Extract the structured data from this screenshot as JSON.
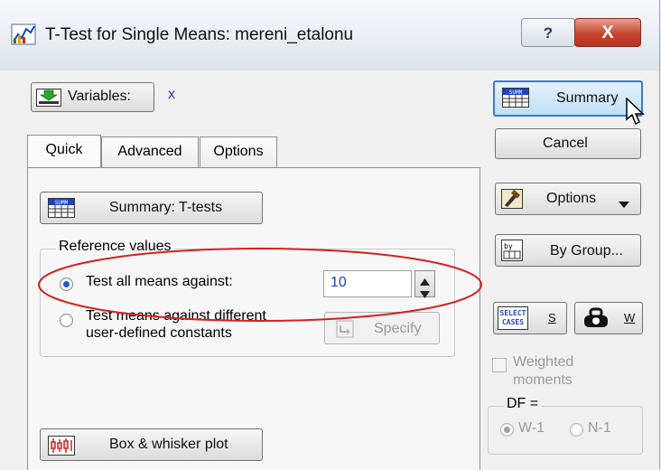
{
  "window": {
    "title": "T-Test for Single Means: mereni_etalonu",
    "help_glyph": "?",
    "close_glyph": "X"
  },
  "variables": {
    "button_label": "Variables:",
    "value": "x"
  },
  "tabs": [
    {
      "label": "Quick"
    },
    {
      "label": "Advanced"
    },
    {
      "label": "Options"
    }
  ],
  "quick": {
    "summary_ttests_label": "Summary: T-tests",
    "reference_group_title": "Reference values",
    "radio_all_label": "Test all means against:",
    "radio_all_selected": true,
    "means_value": "10",
    "radio_diff_label_line1": "Test means against different",
    "radio_diff_label_line2": "user-defined constants",
    "specify_label": "Specify",
    "box_whisker_label": "Box & whisker plot"
  },
  "side": {
    "summary_label": "Summary",
    "cancel_label": "Cancel",
    "options_label": "Options",
    "bygroup_label": "By Group...",
    "select_cases_icon_text_1": "SELECT",
    "select_cases_icon_text_2": "CASES",
    "select_cases_key": "S",
    "weight_key": "W",
    "weighted_label_1": "Weighted",
    "weighted_label_2": "moments",
    "df_title": "DF =",
    "df_w1": "W-1",
    "df_n1": "N-1",
    "df_selected": "W-1"
  },
  "colors": {
    "accent_blue": "#1f3fbf",
    "annotation_red": "#d42020",
    "disabled_text": "#9a9a9a"
  }
}
